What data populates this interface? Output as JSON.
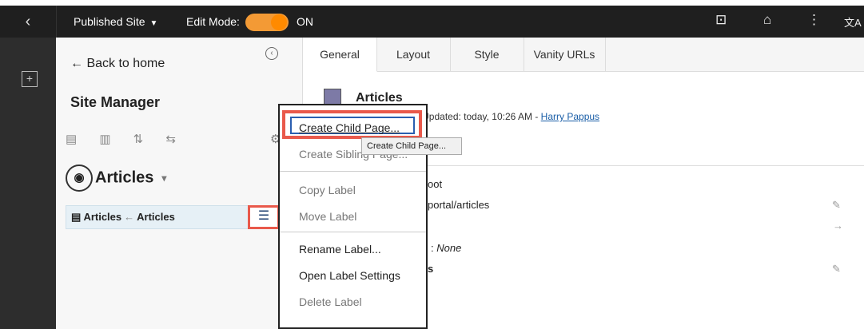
{
  "topbar": {
    "back_icon": "‹",
    "site_label": "Published Site",
    "site_caret": "▼",
    "edit_label": "Edit Mode:",
    "edit_state": "ON",
    "icons": {
      "page": "⊡",
      "home": "⌂",
      "more": "⋮",
      "translate": "文A"
    }
  },
  "leftrail": {
    "add_icon": "+"
  },
  "sidebar": {
    "back_arrow": "←",
    "back_label": "Back to home",
    "collapse_icon": "‹",
    "title": "Site Manager",
    "tools_icons": "▤ ▥ ⇅ ⇆",
    "gear": "⚙",
    "site_globe": "◉",
    "site_name": "Articles",
    "site_caret": "▾",
    "tree_row": {
      "icon": "▤",
      "label_a": "Articles",
      "arrow": "←",
      "label_b": "Articles"
    },
    "menu_icon": "☰"
  },
  "main": {
    "tabs": [
      "General",
      "Layout",
      "Style",
      "Vanity URLs"
    ],
    "page_title": "Articles",
    "meta_prefix": "ed",
    "meta_updated": "Updated: today, 10:26 AM -",
    "meta_user": "Harry Pappus",
    "props": {
      "root": "oot",
      "path": "portal/articles",
      "none": "None",
      "s_frag": "s",
      "colon": ":"
    },
    "pencil": "✎",
    "arrow": "→"
  },
  "context_menu": {
    "items": [
      "Create Child Page...",
      "Create Sibling Page...",
      "Copy Label",
      "Move Label",
      "Rename Label...",
      "Open Label Settings",
      "Delete Label"
    ]
  },
  "tooltip": "Create Child Page..."
}
